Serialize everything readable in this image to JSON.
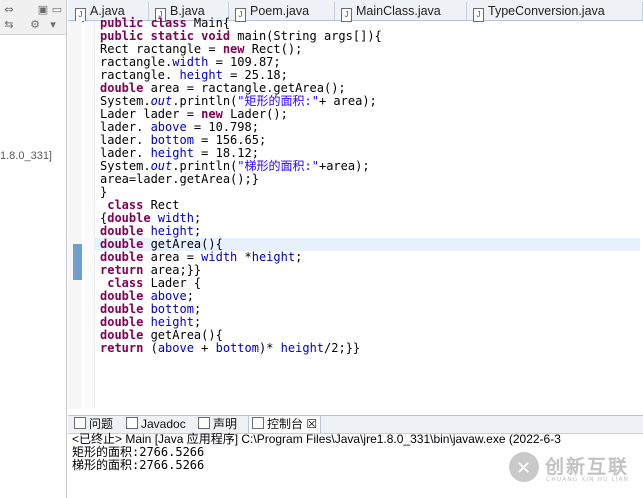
{
  "editor": {
    "tabs": [
      "A.java",
      "B.java",
      "Poem.java",
      "MainClass.java",
      "TypeConversion.java"
    ],
    "lines": [
      [
        {
          "t": "public class ",
          "c": "kw"
        },
        {
          "t": "Main{",
          "c": ""
        }
      ],
      [
        {
          "t": "public static void ",
          "c": "kw"
        },
        {
          "t": "main(String args[]){",
          "c": ""
        }
      ],
      [
        {
          "t": "Rect ractangle = ",
          "c": ""
        },
        {
          "t": "new ",
          "c": "kw"
        },
        {
          "t": "Rect();",
          "c": ""
        }
      ],
      [
        {
          "t": "ractangle.",
          "c": ""
        },
        {
          "t": "width",
          "c": "fld"
        },
        {
          "t": " = 109.87;",
          "c": ""
        }
      ],
      [
        {
          "t": "ractangle. ",
          "c": ""
        },
        {
          "t": "height",
          "c": "fld"
        },
        {
          "t": " = 25.18;",
          "c": ""
        }
      ],
      [
        {
          "t": "double ",
          "c": "kw"
        },
        {
          "t": "area = ractangle.getArea();",
          "c": ""
        }
      ],
      [
        {
          "t": "System.",
          "c": ""
        },
        {
          "t": "out",
          "c": "st"
        },
        {
          "t": ".println(",
          "c": ""
        },
        {
          "t": "\"矩形的面积:\"",
          "c": "str"
        },
        {
          "t": "+ area);",
          "c": ""
        }
      ],
      [
        {
          "t": "Lader lader = ",
          "c": ""
        },
        {
          "t": "new ",
          "c": "kw"
        },
        {
          "t": "Lader();",
          "c": ""
        }
      ],
      [
        {
          "t": "lader. ",
          "c": ""
        },
        {
          "t": "above",
          "c": "fld"
        },
        {
          "t": " = 10.798;",
          "c": ""
        }
      ],
      [
        {
          "t": "lader. ",
          "c": ""
        },
        {
          "t": "bottom",
          "c": "fld"
        },
        {
          "t": " = 156.65;",
          "c": ""
        }
      ],
      [
        {
          "t": "lader. ",
          "c": ""
        },
        {
          "t": "height",
          "c": "fld"
        },
        {
          "t": " = 18.12;",
          "c": ""
        }
      ],
      [
        {
          "t": "System.",
          "c": ""
        },
        {
          "t": "out",
          "c": "st"
        },
        {
          "t": ".println(",
          "c": ""
        },
        {
          "t": "\"梯形的面积:\"",
          "c": "str"
        },
        {
          "t": "+area);",
          "c": ""
        }
      ],
      [
        {
          "t": "area=lader.getArea();}",
          "c": ""
        }
      ],
      [
        {
          "t": "}",
          "c": ""
        }
      ],
      [
        {
          "t": " class ",
          "c": "kw"
        },
        {
          "t": "Rect",
          "c": ""
        }
      ],
      [
        {
          "t": "{",
          "c": ""
        },
        {
          "t": "double ",
          "c": "kw"
        },
        {
          "t": "width",
          "c": "fld"
        },
        {
          "t": ";",
          "c": ""
        }
      ],
      [
        {
          "t": "double ",
          "c": "kw"
        },
        {
          "t": "height",
          "c": "fld"
        },
        {
          "t": ";",
          "c": ""
        }
      ],
      [
        {
          "t": "double ",
          "c": "kw"
        },
        {
          "t": "getArea(){",
          "c": ""
        }
      ],
      [
        {
          "t": "double ",
          "c": "kw"
        },
        {
          "t": "area = ",
          "c": ""
        },
        {
          "t": "width",
          "c": "fld"
        },
        {
          "t": " *",
          "c": ""
        },
        {
          "t": "height",
          "c": "fld"
        },
        {
          "t": ";",
          "c": ""
        }
      ],
      [
        {
          "t": "return ",
          "c": "kw"
        },
        {
          "t": "area;}}",
          "c": ""
        }
      ],
      [
        {
          "t": " class ",
          "c": "kw"
        },
        {
          "t": "Lader {",
          "c": ""
        }
      ],
      [
        {
          "t": "double ",
          "c": "kw"
        },
        {
          "t": "above",
          "c": "fld"
        },
        {
          "t": ";",
          "c": ""
        }
      ],
      [
        {
          "t": "double ",
          "c": "kw"
        },
        {
          "t": "bottom",
          "c": "fld"
        },
        {
          "t": ";",
          "c": ""
        }
      ],
      [
        {
          "t": "double ",
          "c": "kw"
        },
        {
          "t": "height",
          "c": "fld"
        },
        {
          "t": ";",
          "c": ""
        }
      ],
      [
        {
          "t": "double ",
          "c": "kw"
        },
        {
          "t": "getArea(){",
          "c": ""
        }
      ],
      [
        {
          "t": "return ",
          "c": "kw"
        },
        {
          "t": "(",
          "c": ""
        },
        {
          "t": "above",
          "c": "fld"
        },
        {
          "t": " + ",
          "c": ""
        },
        {
          "t": "bottom",
          "c": "fld"
        },
        {
          "t": ")* ",
          "c": ""
        },
        {
          "t": "height",
          "c": "fld"
        },
        {
          "t": "/2;}}",
          "c": ""
        }
      ]
    ],
    "highlighted_line": 17
  },
  "sidebar": {
    "jre_label": "1.8.0_331]"
  },
  "bottom_panel": {
    "tabs": [
      "问题",
      "Javadoc",
      "声明",
      "控制台 ☒"
    ],
    "console_header": "<已终止> Main [Java 应用程序] C:\\Program Files\\Java\\jre1.8.0_331\\bin\\javaw.exe  (2022-6-3",
    "output": [
      "矩形的面积:2766.5266",
      "梯形的面积:2766.5266"
    ]
  },
  "watermark": {
    "text": "创新互联",
    "sub": "CHUANG XIN HU LIAN"
  },
  "colors": {
    "keyword": "#7f0055",
    "field": "#0000c0",
    "string": "#2a00ff",
    "marker": "#6d9fd0"
  }
}
